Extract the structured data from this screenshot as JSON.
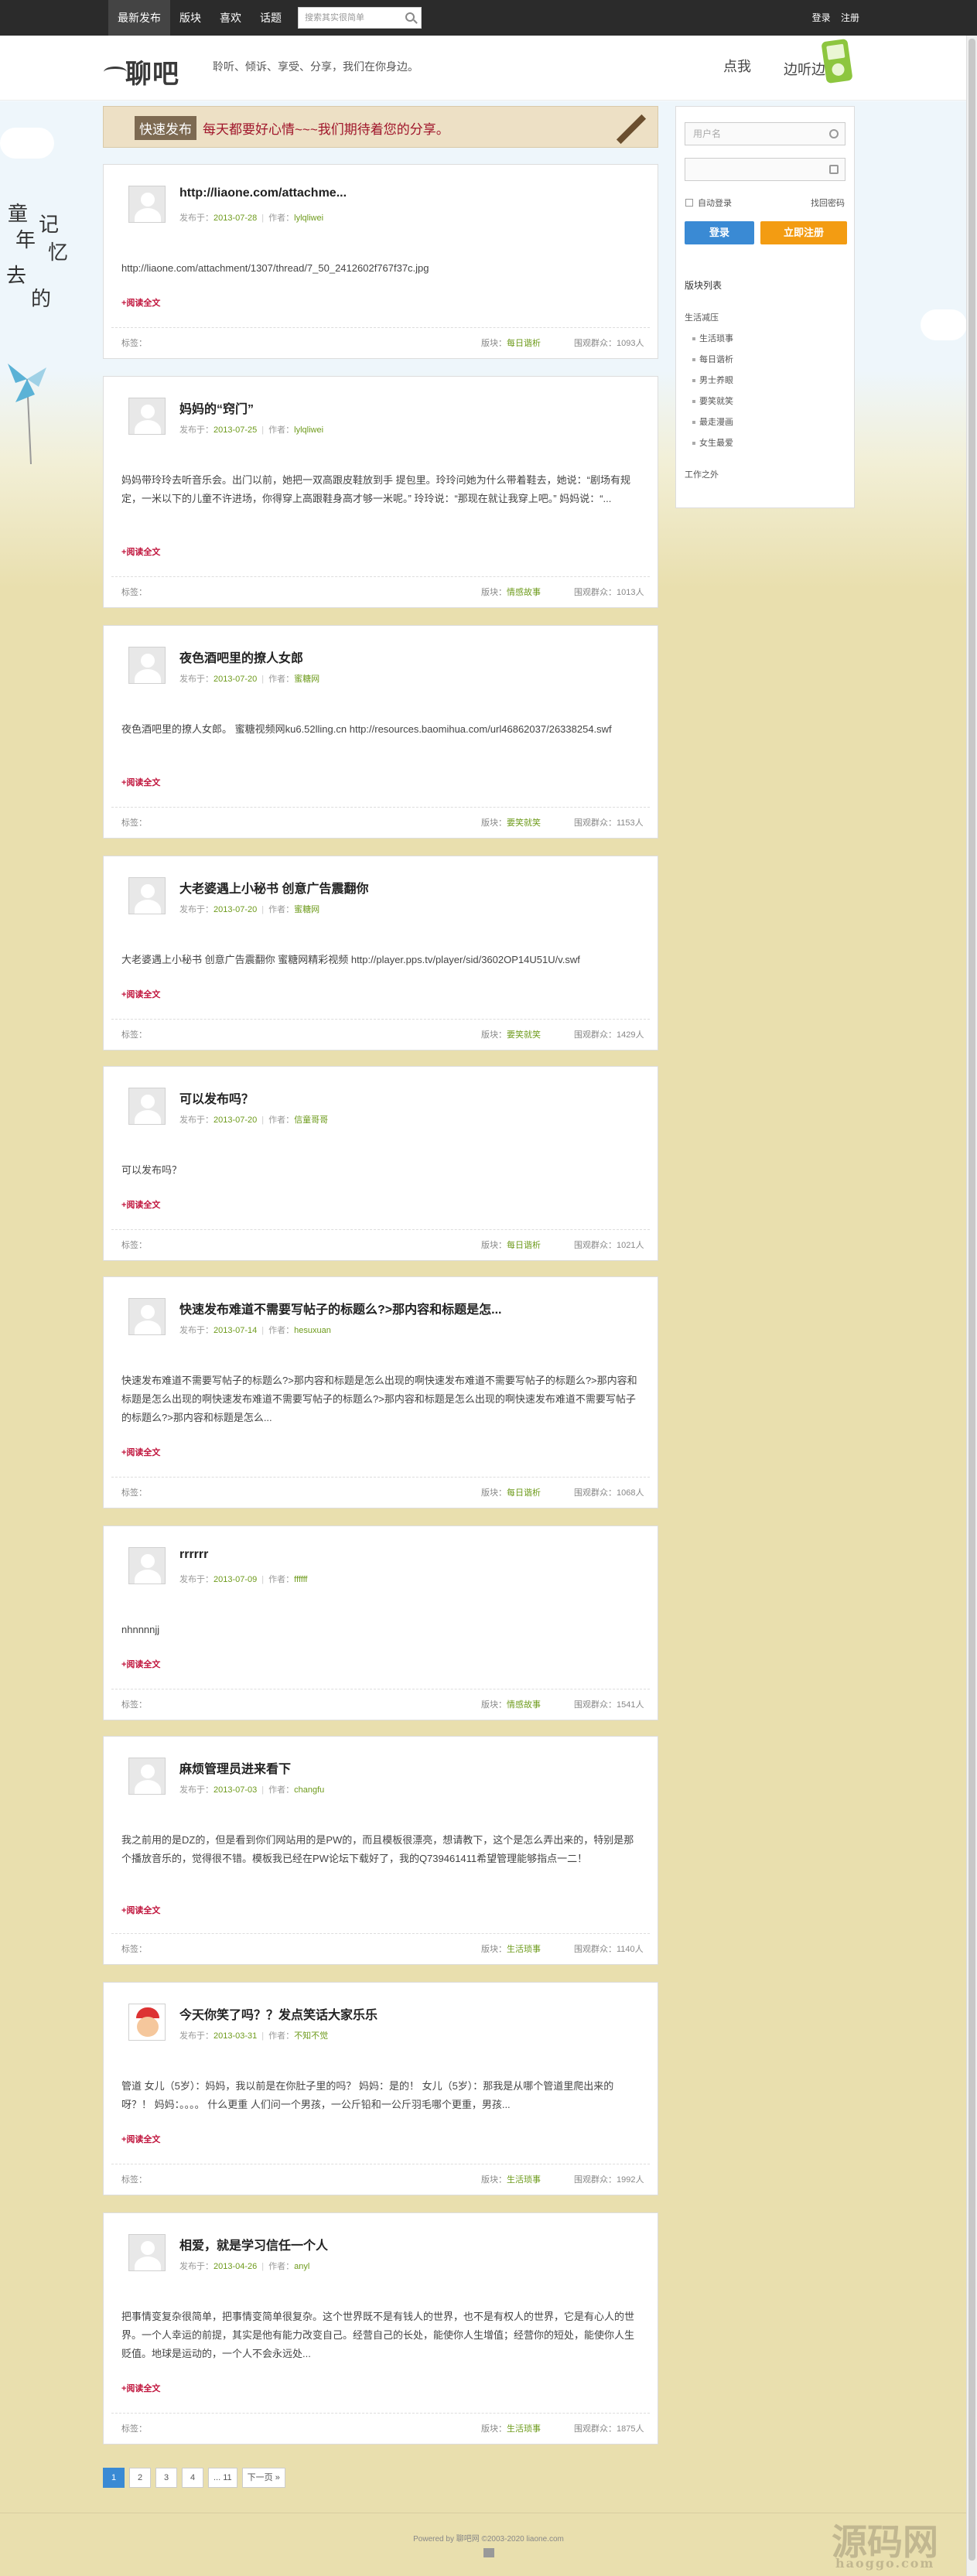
{
  "topbar": {
    "nav": [
      "最新发布",
      "版块",
      "喜欢",
      "话题"
    ],
    "search_placeholder": "搜索其实很简单",
    "login": "登录",
    "register": "注册"
  },
  "header": {
    "logo_text": "聊吧",
    "slogan": "聆听、倾诉、享受、分享，我们在你身边。",
    "right_a": "点我",
    "right_b": "边听边看"
  },
  "banner": {
    "tag": "快速发布",
    "text": "每天都要好心情~~~我们期待着您的分享。"
  },
  "labels": {
    "published": "发布于：",
    "author": "作者：",
    "read_more": "+阅读全文",
    "tags": "标签：",
    "board": "版块：",
    "views": "围观群众："
  },
  "posts": [
    {
      "title": "http://liaone.com/attachme...",
      "date": "2013-07-28",
      "author": "lylqliwei",
      "body": "http://liaone.com/attachment/1307/thread/7_50_2412602f767f37c.jpg",
      "board": "每日谐析",
      "views": "1093人"
    },
    {
      "title": "妈妈的“窍门”",
      "date": "2013-07-25",
      "author": "lylqliwei",
      "body": "妈妈带玲玲去听音乐会。出门以前，她把一双高跟皮鞋放到手 提包里。玲玲问她为什么带着鞋去，她说：“剧场有规定，一米以下的儿童不许进场，你得穿上高跟鞋身高才够一米呢。” 玲玲说：“那现在就让我穿上吧。” 妈妈说：“...",
      "board": "情感故事",
      "views": "1013人"
    },
    {
      "title": "夜色酒吧里的撩人女郎",
      "date": "2013-07-20",
      "author": "蜜糖网",
      "body": "夜色酒吧里的撩人女郎。 蜜糖视频网ku6.52lling.cn http://resources.baomihua.com/url46862037/26338254.swf",
      "board": "要笑就笑",
      "views": "1153人"
    },
    {
      "title": "大老婆遇上小秘书 创意广告震翻你",
      "date": "2013-07-20",
      "author": "蜜糖网",
      "body": "大老婆遇上小秘书 创意广告震翻你 蜜糖网精彩视频 http://player.pps.tv/player/sid/3602OP14U51U/v.swf",
      "board": "要笑就笑",
      "views": "1429人"
    },
    {
      "title": "可以发布吗？",
      "date": "2013-07-20",
      "author": "信童哥哥",
      "body": "可以发布吗？",
      "board": "每日谐析",
      "views": "1021人"
    },
    {
      "title": "快速发布难道不需要写帖子的标题么?>那内容和标题是怎...",
      "date": "2013-07-14",
      "author": "hesuxuan",
      "body": "快速发布难道不需要写帖子的标题么?>那内容和标题是怎么出现的啊快速发布难道不需要写帖子的标题么?>那内容和标题是怎么出现的啊快速发布难道不需要写帖子的标题么?>那内容和标题是怎么出现的啊快速发布难道不需要写帖子的标题么?>那内容和标题是怎么...",
      "board": "每日谐析",
      "views": "1068人"
    },
    {
      "title": "rrrrrr",
      "date": "2013-07-09",
      "author": "ffffff",
      "body": "nhnnnnjj",
      "board": "情感故事",
      "views": "1541人"
    },
    {
      "title": "麻烦管理员进来看下",
      "date": "2013-07-03",
      "author": "changfu",
      "body": "我之前用的是DZ的，但是看到你们网站用的是PW的，而且模板很漂亮，想请教下，这个是怎么弄出来的，特别是那个播放音乐的，觉得很不错。模板我已经在PW论坛下载好了，我的Q739461411希望管理能够指点一二！",
      "board": "生活琐事",
      "views": "1140人"
    },
    {
      "title": "今天你笑了吗？？发点笑话大家乐乐",
      "date": "2013-03-31",
      "author": "不知不觉",
      "body": "管道 女儿（5岁）：妈妈，我以前是在你肚子里的吗？ 妈妈：是的！ 女儿（5岁）：那我是从哪个管道里爬出来的呀？！ 妈妈：。。。。 什么更重 人们问一个男孩，一公斤铅和一公斤羽毛哪个更重，男孩...",
      "board": "生活琐事",
      "views": "1992人"
    },
    {
      "title": "相爱，就是学习信任一个人",
      "date": "2013-04-26",
      "author": "anyl",
      "body": "把事情变复杂很简单，把事情变简单很复杂。这个世界既不是有钱人的世界，也不是有权人的世界，它是有心人的世界。一个人幸运的前提，其实是他有能力改变自己。经营自己的长处，能使你人生增值；经营你的短处，能使你人生贬值。地球是运动的，一个人不会永远处...",
      "board": "生活琐事",
      "views": "1875人"
    }
  ],
  "sidebar": {
    "username_placeholder": "用户名",
    "auto_login": "自动登录",
    "forgot": "找回密码",
    "login_btn": "登录",
    "register_btn": "立即注册",
    "board_list_title": "版块列表",
    "cat1": "生活减压",
    "subs": [
      "生活琐事",
      "每日谐析",
      "男士养眼",
      "要笑就笑",
      "最走漫画",
      "女生最爱"
    ],
    "cat2": "工作之外"
  },
  "pager": {
    "pages": [
      "1",
      "2",
      "3",
      "4",
      "... 11"
    ],
    "next": "下一页 »"
  },
  "footer": {
    "text": "Powered by 聊吧网 ©2003-2020 liaone.com"
  },
  "watermark": {
    "big": "源码网",
    "small": "haoggo.com"
  },
  "deco": {
    "lines": [
      "童",
      "年",
      "记",
      "忆",
      "去",
      "的"
    ]
  }
}
